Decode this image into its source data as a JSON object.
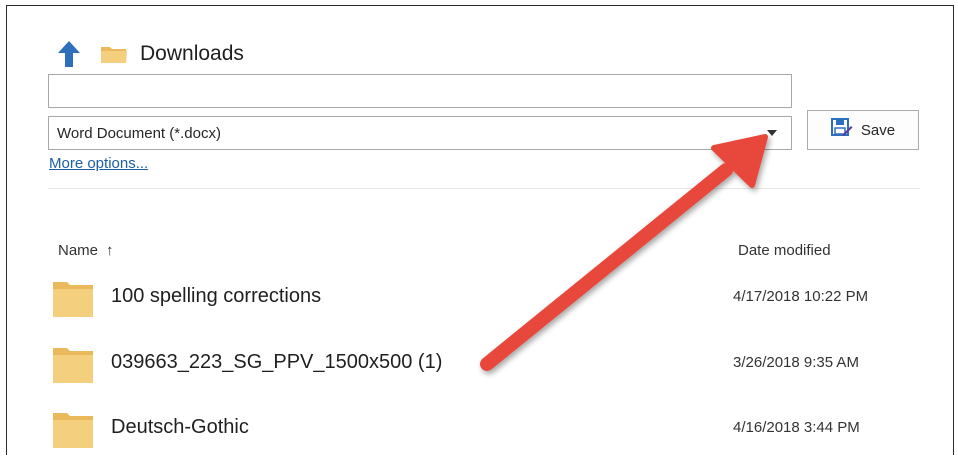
{
  "location": {
    "title": "Downloads",
    "up_icon": "up-arrow-icon",
    "folder_icon": "folder-icon"
  },
  "filename": {
    "value": "",
    "placeholder": ""
  },
  "file_type": {
    "selected": "Word Document (*.docx)",
    "dropdown_icon": "chevron-down-icon"
  },
  "more_options": {
    "label": "More options..."
  },
  "save_button": {
    "label": "Save",
    "icon": "save-icon"
  },
  "columns": {
    "name": "Name",
    "sort_glyph": "↑",
    "date": "Date modified"
  },
  "files": [
    {
      "name": "100 spelling corrections",
      "date": "4/17/2018 10:22 PM"
    },
    {
      "name": "039663_223_SG_PPV_1500x500 (1)",
      "date": "3/26/2018 9:35 AM"
    },
    {
      "name": "Deutsch-Gothic",
      "date": "4/16/2018 3:44 PM"
    }
  ],
  "colors": {
    "accent_blue": "#2e6fbd",
    "folder_yellow": "#f3cf7e",
    "annotation_red": "#e8463a",
    "link_blue": "#1e5fa8"
  }
}
